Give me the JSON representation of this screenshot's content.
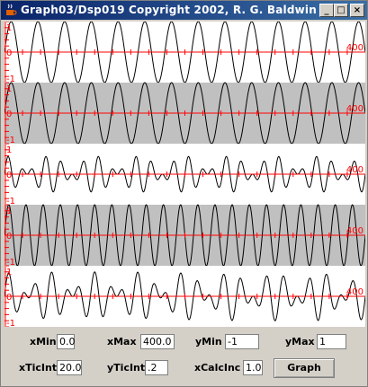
{
  "window": {
    "title": "Graph03/Dsp019 Copyright 2002, R. G. Baldwin",
    "buttons": {
      "minimize": "_",
      "maximize": "□",
      "close": "×"
    }
  },
  "plots": {
    "x_axis_end_label": "400",
    "y_top_label": "1",
    "y_zero_label": "0",
    "y_bottom_label": "-1",
    "stripe_colors": [
      "#ffffff",
      "#c0c0c0"
    ],
    "axis_color": "#ff0000",
    "curve_color": "#000000"
  },
  "chart_data": {
    "type": "line",
    "x_range": [
      0,
      400
    ],
    "y_range": [
      -1,
      1
    ],
    "x_tick_interval": 20,
    "y_tick_interval": 0.2,
    "series": [
      {
        "cycles_per_400": 13.5,
        "amplitude": 1.0
      },
      {
        "cycles_per_400": 13.5,
        "amplitude": 1.0
      },
      {
        "cycles_per_400": 24.0,
        "amplitude": 0.6,
        "mod_cycles": 4.0
      },
      {
        "cycles_per_400": 21.0,
        "amplitude": 1.0
      },
      {
        "cycles_per_400": 21.0,
        "amplitude": 0.8,
        "mod_cycles": 4.0
      }
    ]
  },
  "controls": {
    "xMin": {
      "label": "xMin",
      "value": "0.0"
    },
    "xMax": {
      "label": "xMax",
      "value": "400.0"
    },
    "yMin": {
      "label": "yMin",
      "value": "-1"
    },
    "yMax": {
      "label": "yMax",
      "value": "1"
    },
    "xTicInt": {
      "label": "xTicInt",
      "value": "20.0"
    },
    "yTicInt": {
      "label": "yTicInt",
      "value": ".2"
    },
    "xCalcInc": {
      "label": "xCalcInc",
      "value": "1.0"
    },
    "graph_button": "Graph"
  }
}
